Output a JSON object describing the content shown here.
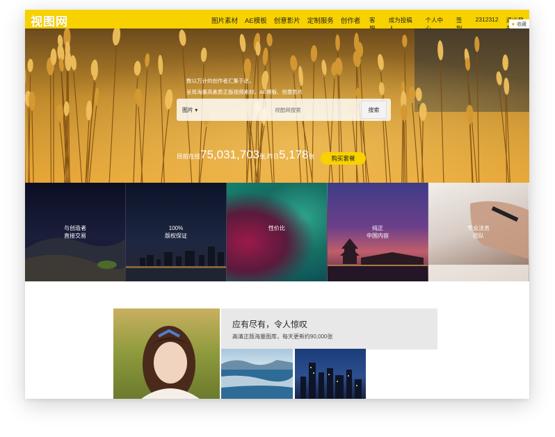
{
  "header": {
    "logo": "视图网",
    "main_nav": [
      "图片素材",
      "AE模板",
      "创意影片",
      "定制服务",
      "创作者"
    ],
    "sub_nav": [
      "客服",
      "成为投稿人",
      "个人中心",
      "签到",
      "2312312",
      "退出登录"
    ],
    "favorite_label": "收藏"
  },
  "hero": {
    "tagline1": "数以万计的创作者汇集于此，",
    "tagline2": "呈现海量高素质正版视频素材、AE模板、创意影片",
    "search": {
      "category": "图片 ▾",
      "placeholder": "视酷网搜索",
      "button": "搜索"
    },
    "stats": {
      "prefix": "目前在线",
      "online_count": "75,031,703",
      "middle": "张,昨日",
      "yesterday_count": "5,178",
      "suffix": "张"
    },
    "buy_button": "购买套餐"
  },
  "features": [
    {
      "line1": "与创造者",
      "line2": "直接交易"
    },
    {
      "line1": "100%",
      "line2": "版权保证"
    },
    {
      "line1": "性价比",
      "line2": ""
    },
    {
      "line1": "纯正",
      "line2": "中国内容"
    },
    {
      "line1": "专业法务",
      "line2": "团队"
    }
  ],
  "promo": {
    "title": "应有尽有，令人惊叹",
    "subtitle": "高清正版海量图库，每天更新约90,000张"
  }
}
